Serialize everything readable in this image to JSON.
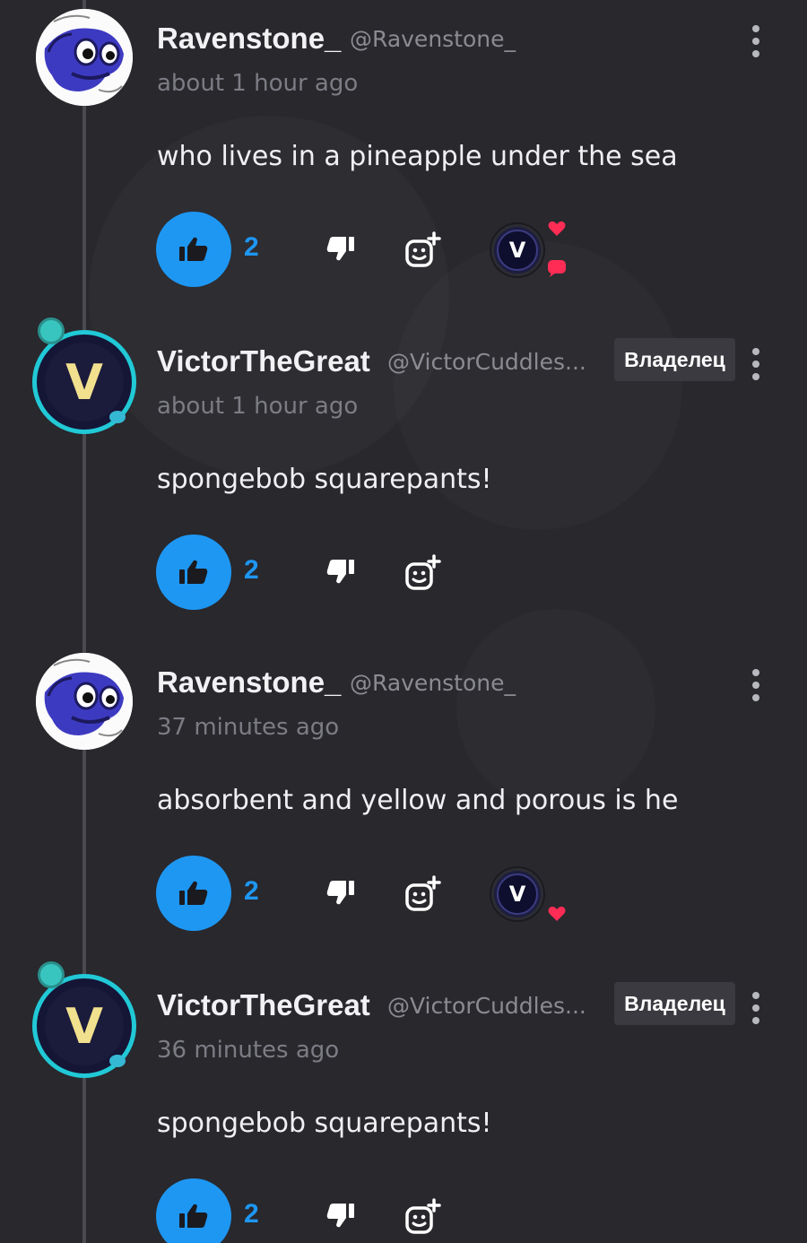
{
  "comments": [
    {
      "name": "Ravenstone_",
      "handle": "@Ravenstone_",
      "time": "about 1 hour ago",
      "text": "who lives in a pineapple under the sea",
      "likes": "2",
      "badge": "",
      "reactions": [
        "heart",
        "chat"
      ]
    },
    {
      "name": "VictorTheGreat",
      "handle": "@VictorCuddles...",
      "time": "about 1 hour ago",
      "text": "spongebob squarepants!",
      "likes": "2",
      "badge": "Владелец",
      "avatar_letter": "V",
      "reactions": []
    },
    {
      "name": "Ravenstone_",
      "handle": "@Ravenstone_",
      "time": "37 minutes ago",
      "text": "absorbent and yellow and porous is he",
      "likes": "2",
      "badge": "",
      "reactions": [
        "heart"
      ]
    },
    {
      "name": "VictorTheGreat",
      "handle": "@VictorCuddles...",
      "time": "36 minutes ago",
      "text": "spongebob squarepants!",
      "likes": "2",
      "badge": "Владелец",
      "avatar_letter": "V",
      "reactions": []
    }
  ],
  "reactor_letter": "V",
  "colors": {
    "background": "#28282d",
    "accent": "#1e97f3",
    "heart": "#ff2d55",
    "frame": "#21c9d6",
    "badge_bg": "#3a3a40"
  },
  "icons": {
    "like": "thumbs-up-icon",
    "dislike": "thumbs-down-icon",
    "react": "add-reaction-icon",
    "more": "more-vertical-icon"
  }
}
